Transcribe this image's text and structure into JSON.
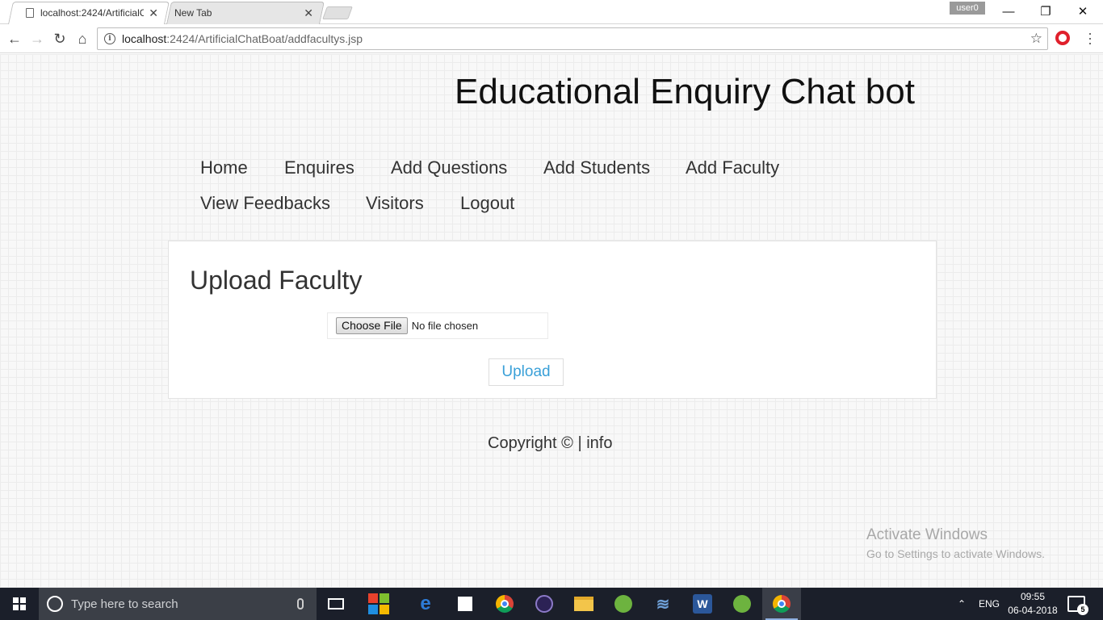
{
  "browser": {
    "tabs": [
      {
        "title": "localhost:2424/ArtificialC",
        "active": true
      },
      {
        "title": "New Tab",
        "active": false
      }
    ],
    "user_badge": "user0",
    "url_host": "localhost",
    "url_path": ":2424/ArtificialChatBoat/addfacultys.jsp",
    "window_controls": {
      "minimize": "—",
      "restore": "❐",
      "close": "✕"
    }
  },
  "page": {
    "site_title": "Educational Enquiry Chat bot",
    "nav": [
      "Home",
      "Enquires",
      "Add Questions",
      "Add Students",
      "Add Faculty",
      "View Feedbacks",
      "Visitors",
      "Logout"
    ],
    "card": {
      "heading": "Upload Faculty",
      "choose_file_label": "Choose File",
      "no_file_text": "No file chosen",
      "upload_label": "Upload"
    },
    "footer": "Copyright © | info",
    "activate_windows": {
      "title": "Activate Windows",
      "subtitle": "Go to Settings to activate Windows."
    }
  },
  "taskbar": {
    "search_placeholder": "Type here to search",
    "language": "ENG",
    "time": "09:55",
    "date": "06-04-2018",
    "notification_count": "5"
  },
  "colors": {
    "upload_text": "#3aa0d8",
    "taskbar_bg": "#1b1f2a",
    "opera_red": "#e0202c"
  }
}
